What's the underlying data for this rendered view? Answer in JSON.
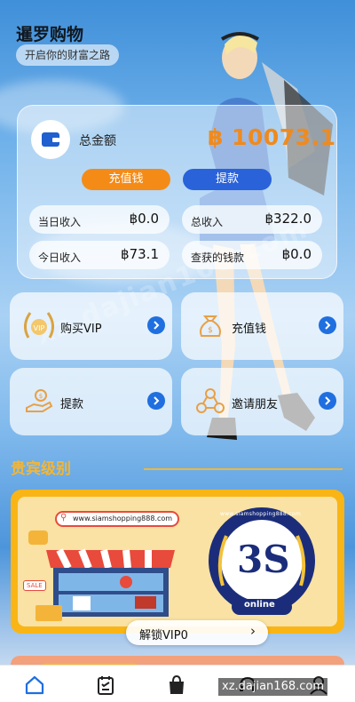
{
  "header": {
    "title": "暹罗购物",
    "subtitle": "开启你的财富之路"
  },
  "balance": {
    "label": "总金额",
    "value": "฿ 10073.1",
    "deposit_button": "充值钱",
    "withdraw_button": "提款"
  },
  "stats": [
    {
      "label": "当日收入",
      "value": "฿0.0"
    },
    {
      "label": "总收入",
      "value": "฿322.0"
    },
    {
      "label": "今日收入",
      "value": "฿73.1"
    },
    {
      "label": "查获的钱款",
      "value": "฿0.0"
    }
  ],
  "menu": [
    {
      "label": "购买VIP",
      "icon": "vip-laurel-icon"
    },
    {
      "label": "充值钱",
      "icon": "money-bag-icon"
    },
    {
      "label": "提款",
      "icon": "hand-coin-icon"
    },
    {
      "label": "邀请朋友",
      "icon": "share-people-icon"
    }
  ],
  "vip": {
    "section_title": "贵宾级别",
    "banner_url_left": "www.siamshopping888.com",
    "banner_url_circle": "www.siamshopping888.com",
    "logo_text": "3S",
    "logo_sub": "online",
    "sale_tag": "SALE",
    "unlock_label": "解锁VIP0",
    "unlock_chevron": "›"
  },
  "tabbar": [
    {
      "name": "home-icon",
      "active": true
    },
    {
      "name": "task-list-icon",
      "active": false
    },
    {
      "name": "shopping-bag-icon",
      "active": false
    },
    {
      "name": "support-headset-icon",
      "active": false
    },
    {
      "name": "user-icon",
      "active": false
    }
  ],
  "watermark": {
    "text": "xz.dajian168.com",
    "diagonal": "xz.dajian168.com"
  },
  "colors": {
    "accent_orange": "#f58b17",
    "accent_blue": "#2a62d9",
    "gold": "#f0b63a",
    "balance_value": "#f08a1c"
  }
}
